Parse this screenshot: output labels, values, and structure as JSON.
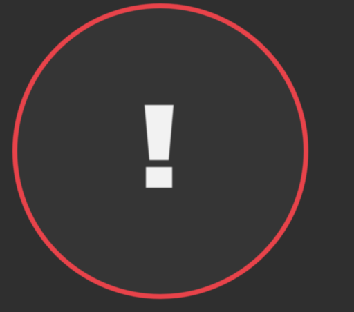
{
  "alert": {
    "icon": "exclamation-icon",
    "ring_color": "#e8434a",
    "fill_color": "#353535",
    "glyph_color": "#f2f2f2",
    "background_color": "#2f2f2f"
  }
}
